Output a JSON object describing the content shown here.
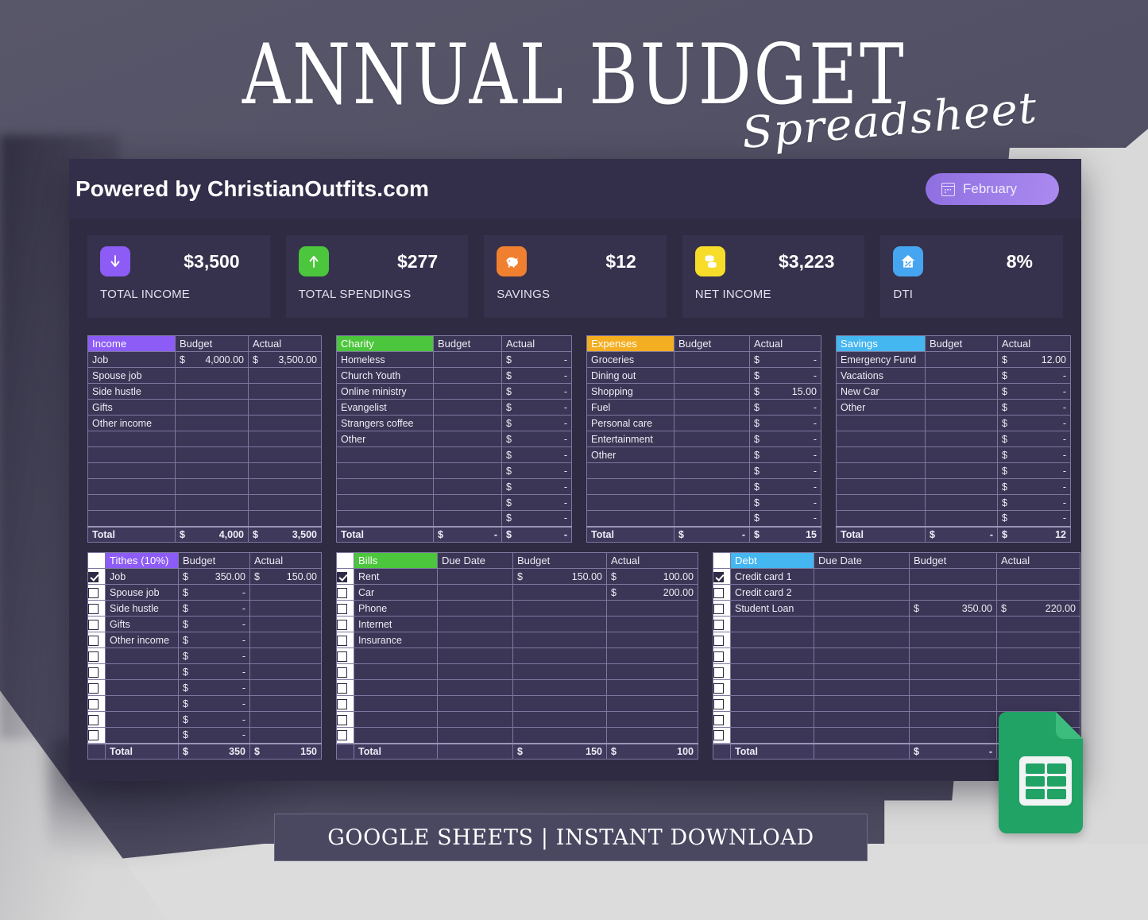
{
  "title": {
    "main": "ANNUAL BUDGET",
    "script": "Spreadsheet"
  },
  "topbar": {
    "brand": "Powered by ChristianOutfits.com",
    "month": "February",
    "calendar_icon": "calendar-icon"
  },
  "cards": [
    {
      "label": "TOTAL INCOME",
      "value": "$3,500",
      "icon": "arrow-down-icon",
      "color": "#8d5cf6"
    },
    {
      "label": "TOTAL SPENDINGS",
      "value": "$277",
      "icon": "arrow-up-icon",
      "color": "#4cc63c"
    },
    {
      "label": "SAVINGS",
      "value": "$12",
      "icon": "piggy-bank-icon",
      "color": "#f08030"
    },
    {
      "label": "NET INCOME",
      "value": "$3,223",
      "icon": "money-stack-icon",
      "color": "#f7dd2a"
    },
    {
      "label": "DTI",
      "value": "8%",
      "icon": "house-percent-icon",
      "color": "#46a5f0"
    }
  ],
  "columns": {
    "budget": "Budget",
    "actual": "Actual",
    "due_date": "Due Date",
    "total": "Total"
  },
  "tables": {
    "income": {
      "title": "Income",
      "accent": "#8d5cf6",
      "rows": [
        {
          "name": "Job",
          "budget_dollar": "$",
          "budget": "4,000.00",
          "actual_dollar": "$",
          "actual": "3,500.00"
        },
        {
          "name": "Spouse job",
          "budget_dollar": "",
          "budget": "",
          "actual_dollar": "",
          "actual": ""
        },
        {
          "name": "Side hustle",
          "budget_dollar": "",
          "budget": "",
          "actual_dollar": "",
          "actual": ""
        },
        {
          "name": "Gifts",
          "budget_dollar": "",
          "budget": "",
          "actual_dollar": "",
          "actual": ""
        },
        {
          "name": "Other income",
          "budget_dollar": "",
          "budget": "",
          "actual_dollar": "",
          "actual": ""
        },
        {
          "name": "",
          "budget_dollar": "",
          "budget": "",
          "actual_dollar": "",
          "actual": ""
        },
        {
          "name": "",
          "budget_dollar": "",
          "budget": "",
          "actual_dollar": "",
          "actual": ""
        },
        {
          "name": "",
          "budget_dollar": "",
          "budget": "",
          "actual_dollar": "",
          "actual": ""
        },
        {
          "name": "",
          "budget_dollar": "",
          "budget": "",
          "actual_dollar": "",
          "actual": ""
        },
        {
          "name": "",
          "budget_dollar": "",
          "budget": "",
          "actual_dollar": "",
          "actual": ""
        },
        {
          "name": "",
          "budget_dollar": "",
          "budget": "",
          "actual_dollar": "",
          "actual": ""
        }
      ],
      "total": {
        "label": "Total",
        "budget_dollar": "$",
        "budget": "4,000",
        "actual_dollar": "$",
        "actual": "3,500"
      }
    },
    "charity": {
      "title": "Charity",
      "accent": "#4cc63c",
      "rows": [
        {
          "name": "Homeless",
          "budget_dollar": "",
          "budget": "",
          "actual_dollar": "$",
          "actual": "-"
        },
        {
          "name": "Church Youth",
          "budget_dollar": "",
          "budget": "",
          "actual_dollar": "$",
          "actual": "-"
        },
        {
          "name": "Online ministry",
          "budget_dollar": "",
          "budget": "",
          "actual_dollar": "$",
          "actual": "-"
        },
        {
          "name": "Evangelist",
          "budget_dollar": "",
          "budget": "",
          "actual_dollar": "$",
          "actual": "-"
        },
        {
          "name": "Strangers coffee",
          "budget_dollar": "",
          "budget": "",
          "actual_dollar": "$",
          "actual": "-"
        },
        {
          "name": "Other",
          "budget_dollar": "",
          "budget": "",
          "actual_dollar": "$",
          "actual": "-"
        },
        {
          "name": "",
          "budget_dollar": "",
          "budget": "",
          "actual_dollar": "$",
          "actual": "-"
        },
        {
          "name": "",
          "budget_dollar": "",
          "budget": "",
          "actual_dollar": "$",
          "actual": "-"
        },
        {
          "name": "",
          "budget_dollar": "",
          "budget": "",
          "actual_dollar": "$",
          "actual": "-"
        },
        {
          "name": "",
          "budget_dollar": "",
          "budget": "",
          "actual_dollar": "$",
          "actual": "-"
        },
        {
          "name": "",
          "budget_dollar": "",
          "budget": "",
          "actual_dollar": "$",
          "actual": "-"
        }
      ],
      "total": {
        "label": "Total",
        "budget_dollar": "$",
        "budget": "-",
        "actual_dollar": "$",
        "actual": "-"
      }
    },
    "expenses": {
      "title": "Expenses",
      "accent": "#f4ae21",
      "rows": [
        {
          "name": "Groceries",
          "budget_dollar": "",
          "budget": "",
          "actual_dollar": "$",
          "actual": "-"
        },
        {
          "name": "Dining out",
          "budget_dollar": "",
          "budget": "",
          "actual_dollar": "$",
          "actual": "-"
        },
        {
          "name": "Shopping",
          "budget_dollar": "",
          "budget": "",
          "actual_dollar": "$",
          "actual": "15.00"
        },
        {
          "name": "Fuel",
          "budget_dollar": "",
          "budget": "",
          "actual_dollar": "$",
          "actual": "-"
        },
        {
          "name": "Personal care",
          "budget_dollar": "",
          "budget": "",
          "actual_dollar": "$",
          "actual": "-"
        },
        {
          "name": "Entertainment",
          "budget_dollar": "",
          "budget": "",
          "actual_dollar": "$",
          "actual": "-"
        },
        {
          "name": "Other",
          "budget_dollar": "",
          "budget": "",
          "actual_dollar": "$",
          "actual": "-"
        },
        {
          "name": "",
          "budget_dollar": "",
          "budget": "",
          "actual_dollar": "$",
          "actual": "-"
        },
        {
          "name": "",
          "budget_dollar": "",
          "budget": "",
          "actual_dollar": "$",
          "actual": "-"
        },
        {
          "name": "",
          "budget_dollar": "",
          "budget": "",
          "actual_dollar": "$",
          "actual": "-"
        },
        {
          "name": "",
          "budget_dollar": "",
          "budget": "",
          "actual_dollar": "$",
          "actual": "-"
        }
      ],
      "total": {
        "label": "Total",
        "budget_dollar": "$",
        "budget": "-",
        "actual_dollar": "$",
        "actual": "15"
      }
    },
    "savings": {
      "title": "Savings",
      "accent": "#44b6f0",
      "rows": [
        {
          "name": "Emergency Fund",
          "budget_dollar": "",
          "budget": "",
          "actual_dollar": "$",
          "actual": "12.00"
        },
        {
          "name": "Vacations",
          "budget_dollar": "",
          "budget": "",
          "actual_dollar": "$",
          "actual": "-"
        },
        {
          "name": "New Car",
          "budget_dollar": "",
          "budget": "",
          "actual_dollar": "$",
          "actual": "-"
        },
        {
          "name": "Other",
          "budget_dollar": "",
          "budget": "",
          "actual_dollar": "$",
          "actual": "-"
        },
        {
          "name": "",
          "budget_dollar": "",
          "budget": "",
          "actual_dollar": "$",
          "actual": "-"
        },
        {
          "name": "",
          "budget_dollar": "",
          "budget": "",
          "actual_dollar": "$",
          "actual": "-"
        },
        {
          "name": "",
          "budget_dollar": "",
          "budget": "",
          "actual_dollar": "$",
          "actual": "-"
        },
        {
          "name": "",
          "budget_dollar": "",
          "budget": "",
          "actual_dollar": "$",
          "actual": "-"
        },
        {
          "name": "",
          "budget_dollar": "",
          "budget": "",
          "actual_dollar": "$",
          "actual": "-"
        },
        {
          "name": "",
          "budget_dollar": "",
          "budget": "",
          "actual_dollar": "$",
          "actual": "-"
        },
        {
          "name": "",
          "budget_dollar": "",
          "budget": "",
          "actual_dollar": "$",
          "actual": "-"
        }
      ],
      "total": {
        "label": "Total",
        "budget_dollar": "$",
        "budget": "-",
        "actual_dollar": "$",
        "actual": "12"
      }
    },
    "tithes": {
      "title": "Tithes (10%)",
      "accent": "#8d5cf6",
      "rows": [
        {
          "checked": true,
          "name": "Job",
          "budget_dollar": "$",
          "budget": "350.00",
          "actual_dollar": "$",
          "actual": "150.00"
        },
        {
          "checked": false,
          "name": "Spouse job",
          "budget_dollar": "$",
          "budget": "-",
          "actual_dollar": "",
          "actual": ""
        },
        {
          "checked": false,
          "name": "Side hustle",
          "budget_dollar": "$",
          "budget": "-",
          "actual_dollar": "",
          "actual": ""
        },
        {
          "checked": false,
          "name": "Gifts",
          "budget_dollar": "$",
          "budget": "-",
          "actual_dollar": "",
          "actual": ""
        },
        {
          "checked": false,
          "name": "Other income",
          "budget_dollar": "$",
          "budget": "-",
          "actual_dollar": "",
          "actual": ""
        },
        {
          "checked": false,
          "name": "",
          "budget_dollar": "$",
          "budget": "-",
          "actual_dollar": "",
          "actual": ""
        },
        {
          "checked": false,
          "name": "",
          "budget_dollar": "$",
          "budget": "-",
          "actual_dollar": "",
          "actual": ""
        },
        {
          "checked": false,
          "name": "",
          "budget_dollar": "$",
          "budget": "-",
          "actual_dollar": "",
          "actual": ""
        },
        {
          "checked": false,
          "name": "",
          "budget_dollar": "$",
          "budget": "-",
          "actual_dollar": "",
          "actual": ""
        },
        {
          "checked": false,
          "name": "",
          "budget_dollar": "$",
          "budget": "-",
          "actual_dollar": "",
          "actual": ""
        },
        {
          "checked": false,
          "name": "",
          "budget_dollar": "$",
          "budget": "-",
          "actual_dollar": "",
          "actual": ""
        }
      ],
      "total": {
        "label": "Total",
        "budget_dollar": "$",
        "budget": "350",
        "actual_dollar": "$",
        "actual": "150"
      }
    },
    "bills": {
      "title": "Bills",
      "accent": "#4cc63c",
      "rows": [
        {
          "checked": true,
          "name": "Rent",
          "due": "",
          "budget_dollar": "$",
          "budget": "150.00",
          "actual_dollar": "$",
          "actual": "100.00"
        },
        {
          "checked": false,
          "name": "Car",
          "due": "",
          "budget_dollar": "",
          "budget": "",
          "actual_dollar": "$",
          "actual": "200.00"
        },
        {
          "checked": false,
          "name": "Phone",
          "due": "",
          "budget_dollar": "",
          "budget": "",
          "actual_dollar": "",
          "actual": ""
        },
        {
          "checked": false,
          "name": "Internet",
          "due": "",
          "budget_dollar": "",
          "budget": "",
          "actual_dollar": "",
          "actual": ""
        },
        {
          "checked": false,
          "name": "Insurance",
          "due": "",
          "budget_dollar": "",
          "budget": "",
          "actual_dollar": "",
          "actual": ""
        },
        {
          "checked": false,
          "name": "",
          "due": "",
          "budget_dollar": "",
          "budget": "",
          "actual_dollar": "",
          "actual": ""
        },
        {
          "checked": false,
          "name": "",
          "due": "",
          "budget_dollar": "",
          "budget": "",
          "actual_dollar": "",
          "actual": ""
        },
        {
          "checked": false,
          "name": "",
          "due": "",
          "budget_dollar": "",
          "budget": "",
          "actual_dollar": "",
          "actual": ""
        },
        {
          "checked": false,
          "name": "",
          "due": "",
          "budget_dollar": "",
          "budget": "",
          "actual_dollar": "",
          "actual": ""
        },
        {
          "checked": false,
          "name": "",
          "due": "",
          "budget_dollar": "",
          "budget": "",
          "actual_dollar": "",
          "actual": ""
        },
        {
          "checked": false,
          "name": "",
          "due": "",
          "budget_dollar": "",
          "budget": "",
          "actual_dollar": "",
          "actual": ""
        }
      ],
      "total": {
        "label": "Total",
        "budget_dollar": "$",
        "budget": "150",
        "actual_dollar": "$",
        "actual": "100"
      }
    },
    "debt": {
      "title": "Debt",
      "accent": "#44b6f0",
      "rows": [
        {
          "checked": true,
          "name": "Credit card 1",
          "due": "",
          "budget_dollar": "",
          "budget": "",
          "actual_dollar": "",
          "actual": ""
        },
        {
          "checked": false,
          "name": "Credit card 2",
          "due": "",
          "budget_dollar": "",
          "budget": "",
          "actual_dollar": "",
          "actual": ""
        },
        {
          "checked": false,
          "name": "Student Loan",
          "due": "",
          "budget_dollar": "$",
          "budget": "350.00",
          "actual_dollar": "$",
          "actual": "220.00"
        },
        {
          "checked": false,
          "name": "",
          "due": "",
          "budget_dollar": "",
          "budget": "",
          "actual_dollar": "",
          "actual": ""
        },
        {
          "checked": false,
          "name": "",
          "due": "",
          "budget_dollar": "",
          "budget": "",
          "actual_dollar": "",
          "actual": ""
        },
        {
          "checked": false,
          "name": "",
          "due": "",
          "budget_dollar": "",
          "budget": "",
          "actual_dollar": "",
          "actual": ""
        },
        {
          "checked": false,
          "name": "",
          "due": "",
          "budget_dollar": "",
          "budget": "",
          "actual_dollar": "",
          "actual": ""
        },
        {
          "checked": false,
          "name": "",
          "due": "",
          "budget_dollar": "",
          "budget": "",
          "actual_dollar": "",
          "actual": ""
        },
        {
          "checked": false,
          "name": "",
          "due": "",
          "budget_dollar": "",
          "budget": "",
          "actual_dollar": "",
          "actual": ""
        },
        {
          "checked": false,
          "name": "",
          "due": "",
          "budget_dollar": "",
          "budget": "",
          "actual_dollar": "",
          "actual": ""
        },
        {
          "checked": false,
          "name": "",
          "due": "",
          "budget_dollar": "",
          "budget": "",
          "actual_dollar": "",
          "actual": ""
        }
      ],
      "total": {
        "label": "Total",
        "budget_dollar": "$",
        "budget": "-",
        "actual_dollar": "$",
        "actual": ""
      }
    }
  },
  "logo": {
    "name": "google-sheets-logo"
  },
  "banner": {
    "text": "GOOGLE SHEETS  |  INSTANT DOWNLOAD"
  }
}
